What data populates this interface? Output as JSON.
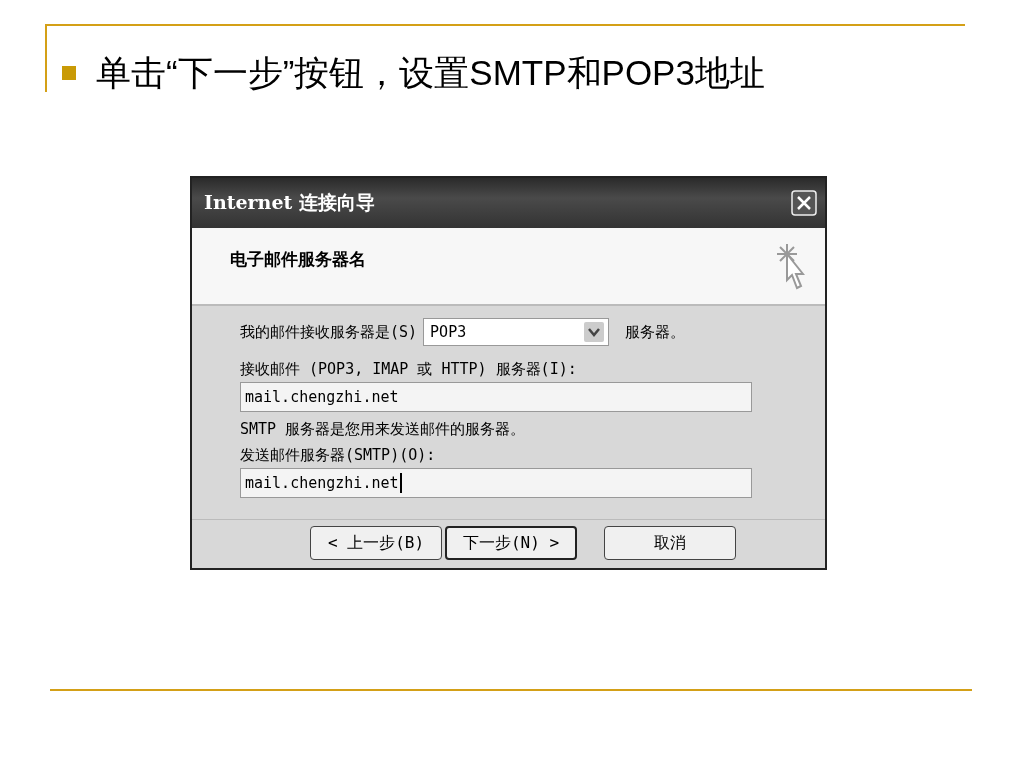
{
  "slide": {
    "bullet": "单击“下一步”按钮，设置SMTP和POP3地址"
  },
  "dialog": {
    "title": "Internet 连接向导",
    "header": "电子邮件服务器名",
    "rows": [
      {
        "kind": "select",
        "label": "我的邮件接收服务器是(S)",
        "value": "POP3",
        "suffix": "服务器。"
      },
      {
        "kind": "label",
        "text": "接收邮件 (POP3, IMAP 或 HTTP) 服务器(I):"
      },
      {
        "kind": "input",
        "value": "mail.chengzhi.net",
        "focused": false
      },
      {
        "kind": "label",
        "text": "SMTP 服务器是您用来发送邮件的服务器。"
      },
      {
        "kind": "label",
        "text": "发送邮件服务器(SMTP)(O):"
      },
      {
        "kind": "input",
        "value": "mail.chengzhi.net",
        "focused": true
      }
    ],
    "buttons": [
      {
        "label": "< 上一步(B)",
        "default": false
      },
      {
        "label": "下一步(N) >",
        "default": true
      },
      {
        "label": "取消",
        "default": false
      }
    ]
  }
}
